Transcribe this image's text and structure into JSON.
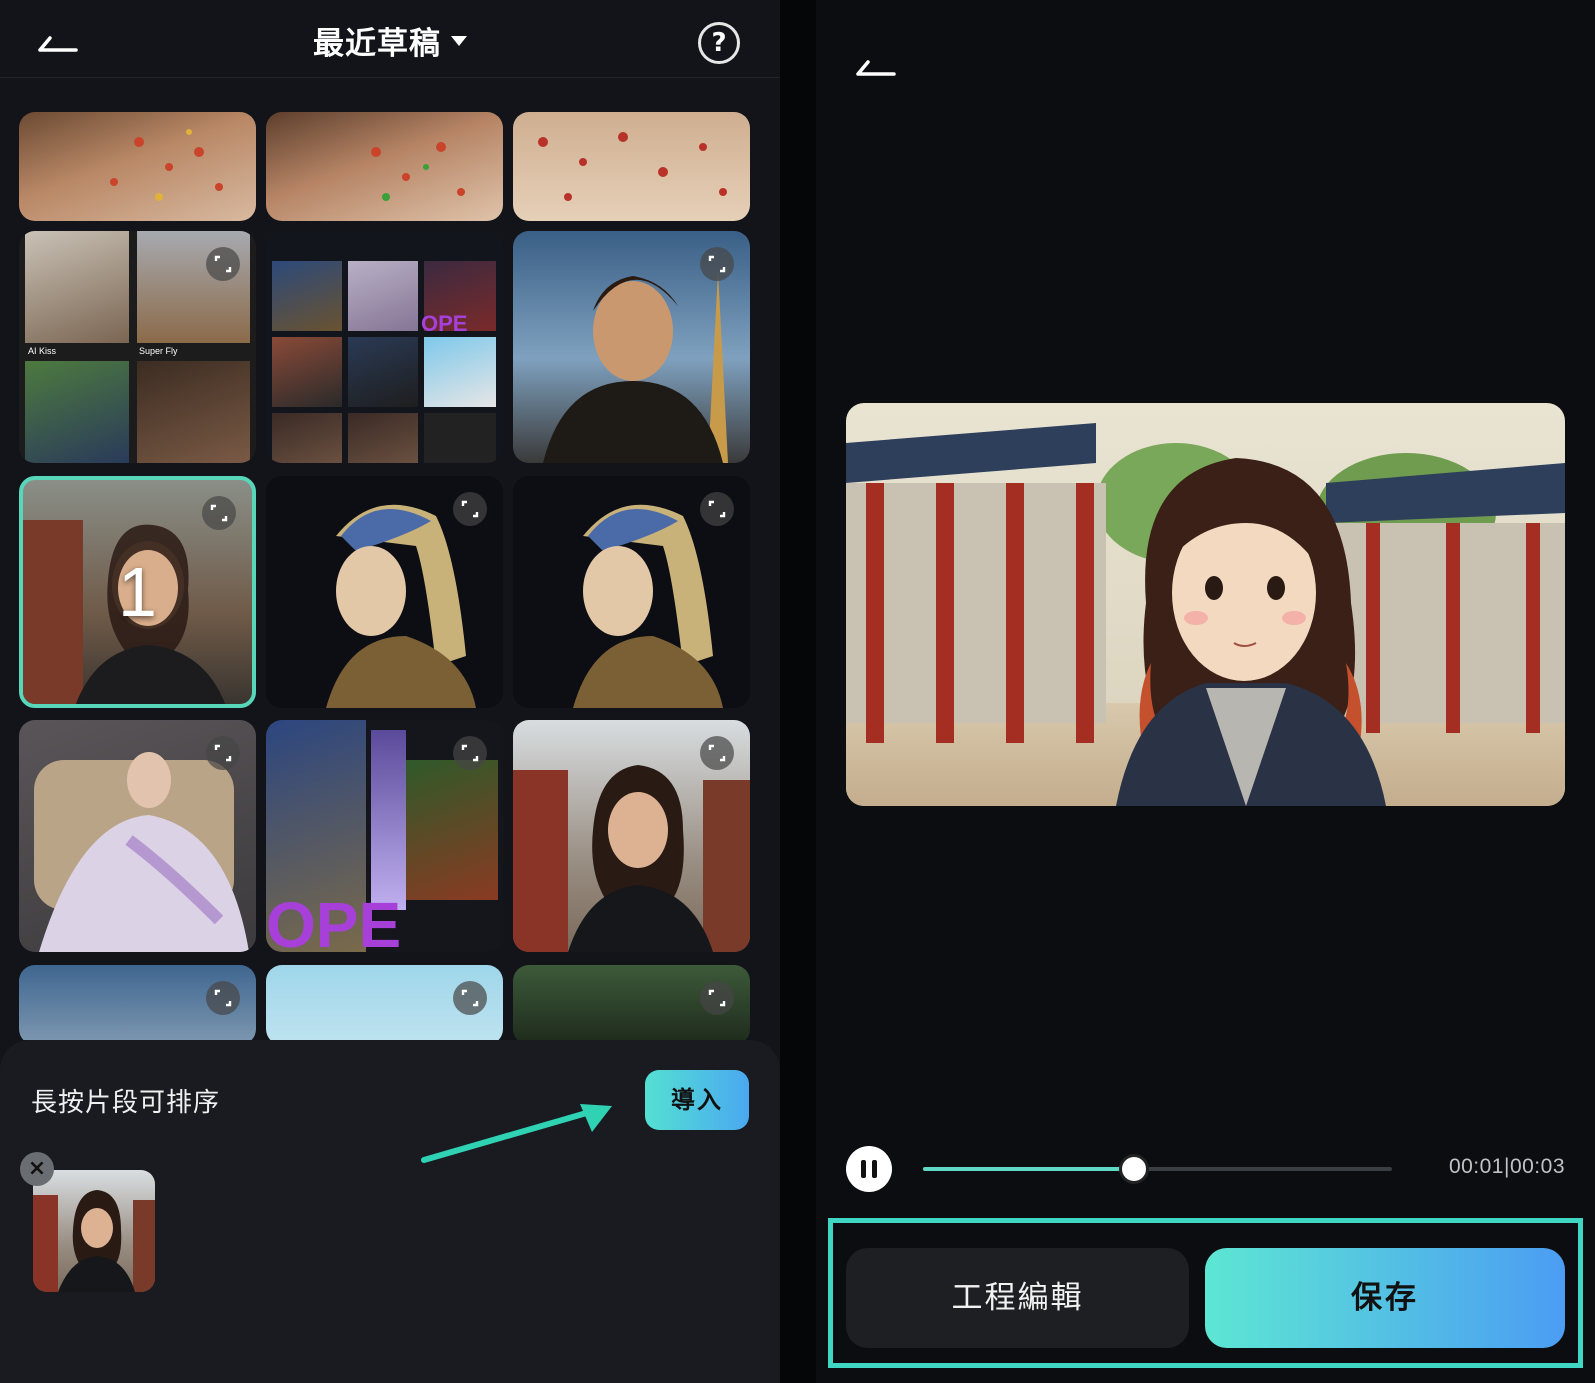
{
  "left_panel": {
    "header": {
      "title": "最近草稿",
      "help_label": "?"
    },
    "grid": {
      "selected_index_label": "1",
      "collage_captions": [
        "AI Kiss",
        "Super Fly"
      ],
      "overlay_text": "OPE"
    },
    "bottom_sheet": {
      "hint": "長按片段可排序",
      "import_label": "導入",
      "remove_label": "×"
    }
  },
  "right_panel": {
    "player": {
      "progress": 0.45,
      "time": "00:01|00:03"
    },
    "actions": {
      "edit_label": "工程編輯",
      "save_label": "保存"
    }
  },
  "colors": {
    "accent": "#58d6b9",
    "button_gradient_start": "#54e0d3",
    "button_gradient_end": "#4aa8f0"
  }
}
